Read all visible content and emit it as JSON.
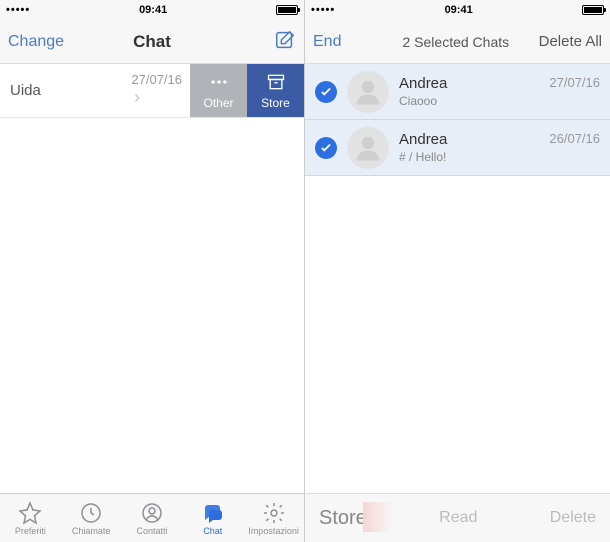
{
  "status": {
    "signal": "•••••",
    "time": "09:41"
  },
  "left": {
    "nav": {
      "left": "Change",
      "title": "Chat"
    },
    "row": {
      "name": "Uida",
      "date": "27/07/16",
      "actions": {
        "other": "Other",
        "store": "Store"
      }
    },
    "tabs": {
      "fav": "Preferiti",
      "calls": "Chiamate",
      "contacts": "Contatti",
      "chat": "Chat",
      "settings": "Impostazioni"
    }
  },
  "right": {
    "nav": {
      "left": "End",
      "title": "2 Selected Chats",
      "right": "Delete All"
    },
    "rows": [
      {
        "name": "Andrea",
        "msg": "Ciaooo",
        "date": "27/07/16"
      },
      {
        "name": "Andrea",
        "msg": "# / Hello!",
        "date": "26/07/16"
      }
    ],
    "toolbar": {
      "store": "Store",
      "read": "Read",
      "delete": "Delete"
    }
  }
}
